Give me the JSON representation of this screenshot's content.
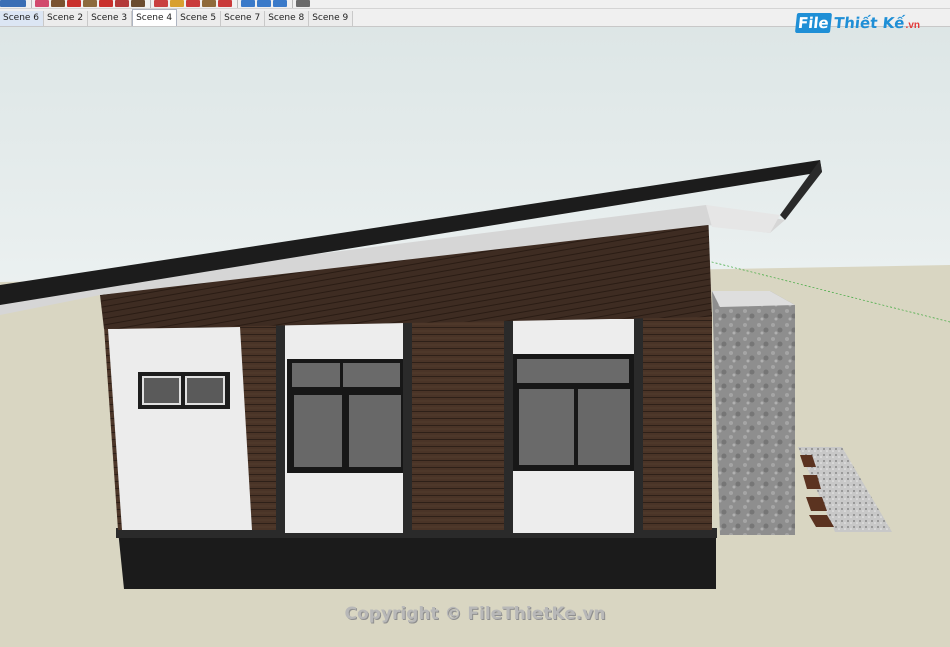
{
  "toolbar": {
    "icons": [
      {
        "name": "select-icon",
        "color": "#3b6fb5"
      },
      {
        "name": "eraser-icon",
        "color": "#d24a6d"
      },
      {
        "name": "line-icon",
        "color": "#7a5230"
      },
      {
        "name": "rectangle-icon",
        "color": "#c9302c"
      },
      {
        "name": "push-pull-icon",
        "color": "#8c6a3c"
      },
      {
        "name": "move-icon",
        "color": "#c9302c"
      },
      {
        "name": "rotate-icon",
        "color": "#b33a3a"
      },
      {
        "name": "paint-bucket-icon",
        "color": "#6b4c2f"
      },
      {
        "name": "tape-measure-icon",
        "color": "#c94040"
      },
      {
        "name": "text-icon",
        "color": "#d8a030"
      },
      {
        "name": "orbit-icon",
        "color": "#c93a3a"
      },
      {
        "name": "pan-icon",
        "color": "#8f6a3a"
      },
      {
        "name": "zoom-icon",
        "color": "#c93a3a"
      },
      {
        "name": "zoom-extents-icon",
        "color": "#3a7ac9"
      },
      {
        "name": "walk-icon",
        "color": "#3a7ac9"
      },
      {
        "name": "look-around-icon",
        "color": "#3a7ac9"
      },
      {
        "name": "section-plane-icon",
        "color": "#6a6a6a"
      }
    ]
  },
  "scenes": {
    "tabs": [
      "Scene 6",
      "Scene 2",
      "Scene 3",
      "Scene 4",
      "Scene 5",
      "Scene 7",
      "Scene 8",
      "Scene 9"
    ],
    "active": "Scene 4"
  },
  "logo": {
    "box_text": "File",
    "text": "Thiết Kế",
    "domain": ".vn"
  },
  "watermark": "Copyright © FileThietKe.vn",
  "colors": {
    "sky_top": "#dde6e6",
    "sky_bottom": "#ffffff",
    "ground": "#d9d6c2",
    "roof_edge": "#1c1c1c",
    "wood": "#4a3427",
    "wall_white": "#ececec",
    "base_black": "#1b1b1b",
    "stone": "#8e8e8e"
  }
}
